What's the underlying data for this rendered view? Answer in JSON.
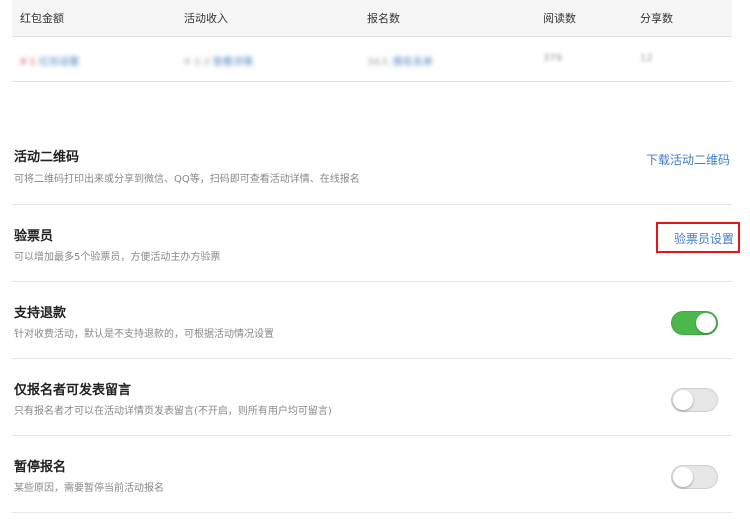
{
  "stats": {
    "headers": [
      "红包金额",
      "活动收入",
      "报名数",
      "阅读数",
      "分享数"
    ],
    "row": {
      "amount": "¥ 1",
      "amount_link": "红包设置",
      "income": "¥ 3.3",
      "income_link": "查看详情",
      "signups": "34人",
      "signups_link": "报名名单",
      "reads": "379",
      "shares": "12"
    }
  },
  "settings": {
    "qrcode": {
      "title": "活动二维码",
      "desc": "可将二维码打印出来或分享到微信、QQ等，扫码即可查看活动详情、在线报名",
      "link": "下载活动二维码"
    },
    "checker": {
      "title": "验票员",
      "desc": "可以增加最多5个验票员，方便活动主办方验票",
      "link": "验票员设置"
    },
    "refund": {
      "title": "支持退款",
      "desc": "针对收费活动，默认是不支持退款的，可根据活动情况设置",
      "enabled": true
    },
    "comment": {
      "title": "仅报名者可发表留言",
      "desc": "只有报名者才可以在活动详情页发表留言(不开启，则所有用户均可留言)",
      "enabled": false
    },
    "pause": {
      "title": "暂停报名",
      "desc": "某些原因，需要暂停当前活动报名",
      "enabled": false
    }
  },
  "colors": {
    "link": "#3f7cc2",
    "toggle_on": "#4cb84c",
    "highlight": "#e8141b"
  }
}
